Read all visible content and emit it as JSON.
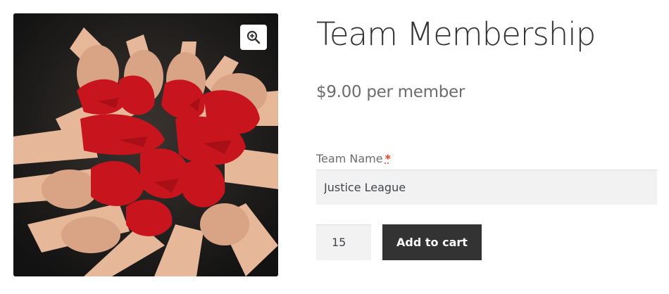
{
  "product": {
    "title": "Team Membership",
    "price": "$9.00 per member",
    "image_icon": "zoom-in-icon"
  },
  "form": {
    "team_name_label": "Team Name",
    "required_mark": "*",
    "team_name_value": "Justice League",
    "quantity_value": "15",
    "add_to_cart_label": "Add to cart"
  },
  "colors": {
    "button": "#333333",
    "input_bg": "#f2f2f2",
    "required": "#e2401c",
    "paint": "#c8141c"
  }
}
